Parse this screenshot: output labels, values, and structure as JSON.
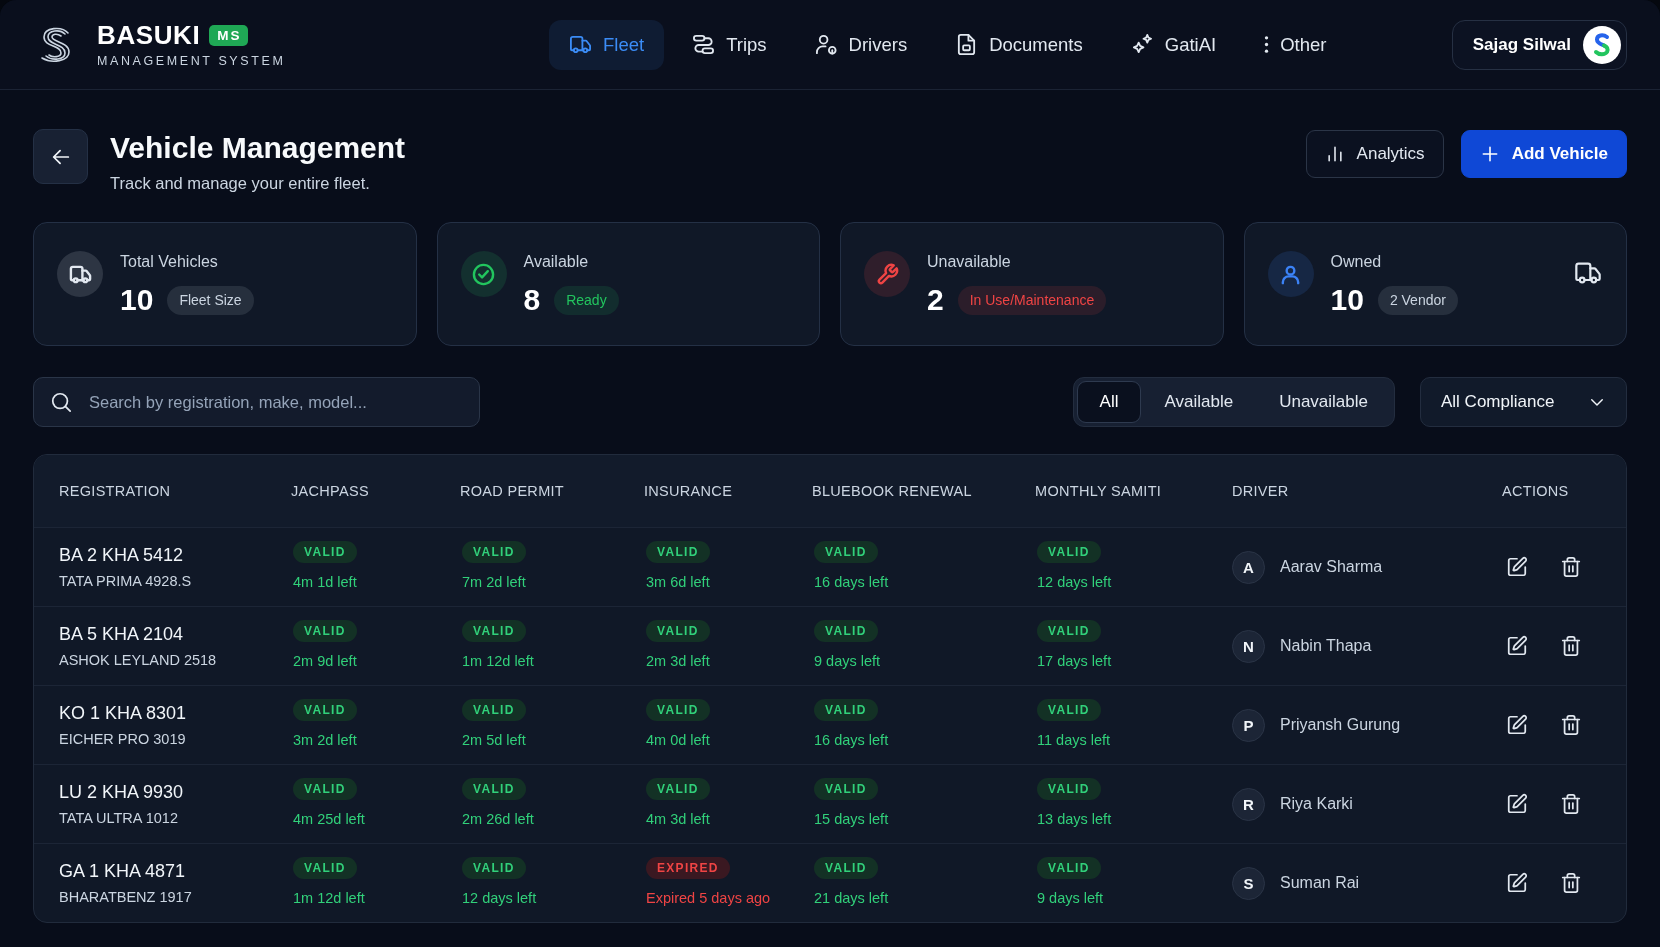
{
  "header": {
    "brand": {
      "name": "BASUKI",
      "badge": "MS",
      "tagline": "MANAGEMENT SYSTEM"
    },
    "nav": [
      {
        "label": "Fleet",
        "selected": true
      },
      {
        "label": "Trips",
        "selected": false
      },
      {
        "label": "Drivers",
        "selected": false
      },
      {
        "label": "Documents",
        "selected": false
      },
      {
        "label": "GatiAI",
        "selected": false
      },
      {
        "label": "Other",
        "selected": false
      }
    ],
    "user": {
      "name": "Sajag Silwal"
    }
  },
  "page": {
    "title": "Vehicle Management",
    "subtitle": "Track and manage your entire fleet.",
    "actions": [
      {
        "label": "Analytics",
        "kind": "secondary"
      },
      {
        "label": "Add Vehicle",
        "kind": "primary"
      }
    ]
  },
  "stats": [
    {
      "kind": "total",
      "label": "Total Vehicles",
      "value": "10",
      "color": "#e2e8f0",
      "tag": {
        "text": "Fleet Size",
        "color": "#cbd5e1"
      }
    },
    {
      "kind": "available",
      "label": "Available",
      "value": "8",
      "color": "#22c55e",
      "tag": {
        "text": "Ready",
        "color": "#22c55e"
      }
    },
    {
      "kind": "unavailable",
      "label": "Unavailable",
      "value": "2",
      "color": "#ef4444",
      "tag": {
        "text": "In Use/Maintenance",
        "color": "#ef4444"
      }
    },
    {
      "kind": "owned",
      "label": "Owned",
      "value": "10",
      "color": "#3b82f6",
      "tag": {
        "text": "2 Vendor",
        "color": "#cbd5e1"
      }
    }
  ],
  "toolbar": {
    "search": {
      "placeholder": "Search by registration, make, model..."
    },
    "filters": [
      {
        "label": "All",
        "selected": true
      },
      {
        "label": "Available",
        "selected": false
      },
      {
        "label": "Unavailable",
        "selected": false
      }
    ],
    "compliance": {
      "value": "All Compliance"
    }
  },
  "table": {
    "columns": [
      "REGISTRATION",
      "JACHPASS",
      "ROAD PERMIT",
      "INSURANCE",
      "BLUEBOOK RENEWAL",
      "MONTHLY SAMITI",
      "DRIVER",
      "ACTIONS"
    ],
    "rows": [
      {
        "registration": "BA 2 KHA 5412",
        "model": "TATA PRIMA 4928.S",
        "documents": [
          {
            "status": "VALID",
            "note": "4m 1d left",
            "expired": false
          },
          {
            "status": "VALID",
            "note": "7m 2d left",
            "expired": false
          },
          {
            "status": "VALID",
            "note": "3m 6d left",
            "expired": false
          },
          {
            "status": "VALID",
            "note": "16 days left",
            "expired": false
          },
          {
            "status": "VALID",
            "note": "12 days left",
            "expired": false
          }
        ],
        "driver": {
          "initial": "A",
          "name": "Aarav Sharma"
        }
      },
      {
        "registration": "BA 5 KHA 2104",
        "model": "ASHOK LEYLAND 2518",
        "documents": [
          {
            "status": "VALID",
            "note": "2m 9d left",
            "expired": false
          },
          {
            "status": "VALID",
            "note": "1m 12d left",
            "expired": false
          },
          {
            "status": "VALID",
            "note": "2m 3d left",
            "expired": false
          },
          {
            "status": "VALID",
            "note": "9 days left",
            "expired": false
          },
          {
            "status": "VALID",
            "note": "17 days left",
            "expired": false
          }
        ],
        "driver": {
          "initial": "N",
          "name": "Nabin Thapa"
        }
      },
      {
        "registration": "KO 1 KHA 8301",
        "model": "EICHER PRO 3019",
        "documents": [
          {
            "status": "VALID",
            "note": "3m 2d left",
            "expired": false
          },
          {
            "status": "VALID",
            "note": "2m 5d left",
            "expired": false
          },
          {
            "status": "VALID",
            "note": "4m 0d left",
            "expired": false
          },
          {
            "status": "VALID",
            "note": "16 days left",
            "expired": false
          },
          {
            "status": "VALID",
            "note": "11 days left",
            "expired": false
          }
        ],
        "driver": {
          "initial": "P",
          "name": "Priyansh Gurung"
        }
      },
      {
        "registration": "LU 2 KHA 9930",
        "model": "TATA ULTRA 1012",
        "documents": [
          {
            "status": "VALID",
            "note": "4m 25d left",
            "expired": false
          },
          {
            "status": "VALID",
            "note": "2m 26d left",
            "expired": false
          },
          {
            "status": "VALID",
            "note": "4m 3d left",
            "expired": false
          },
          {
            "status": "VALID",
            "note": "15 days left",
            "expired": false
          },
          {
            "status": "VALID",
            "note": "13 days left",
            "expired": false
          }
        ],
        "driver": {
          "initial": "R",
          "name": "Riya Karki"
        }
      },
      {
        "registration": "GA 1 KHA 4871",
        "model": "BHARATBENZ 1917",
        "documents": [
          {
            "status": "VALID",
            "note": "1m 12d left",
            "expired": false
          },
          {
            "status": "VALID",
            "note": "12 days left",
            "expired": false
          },
          {
            "status": "EXPIRED",
            "note": "Expired 5 days ago",
            "expired": true
          },
          {
            "status": "VALID",
            "note": "21 days left",
            "expired": false
          },
          {
            "status": "VALID",
            "note": "9 days left",
            "expired": false
          }
        ],
        "driver": {
          "initial": "S",
          "name": "Suman Rai"
        }
      }
    ]
  }
}
